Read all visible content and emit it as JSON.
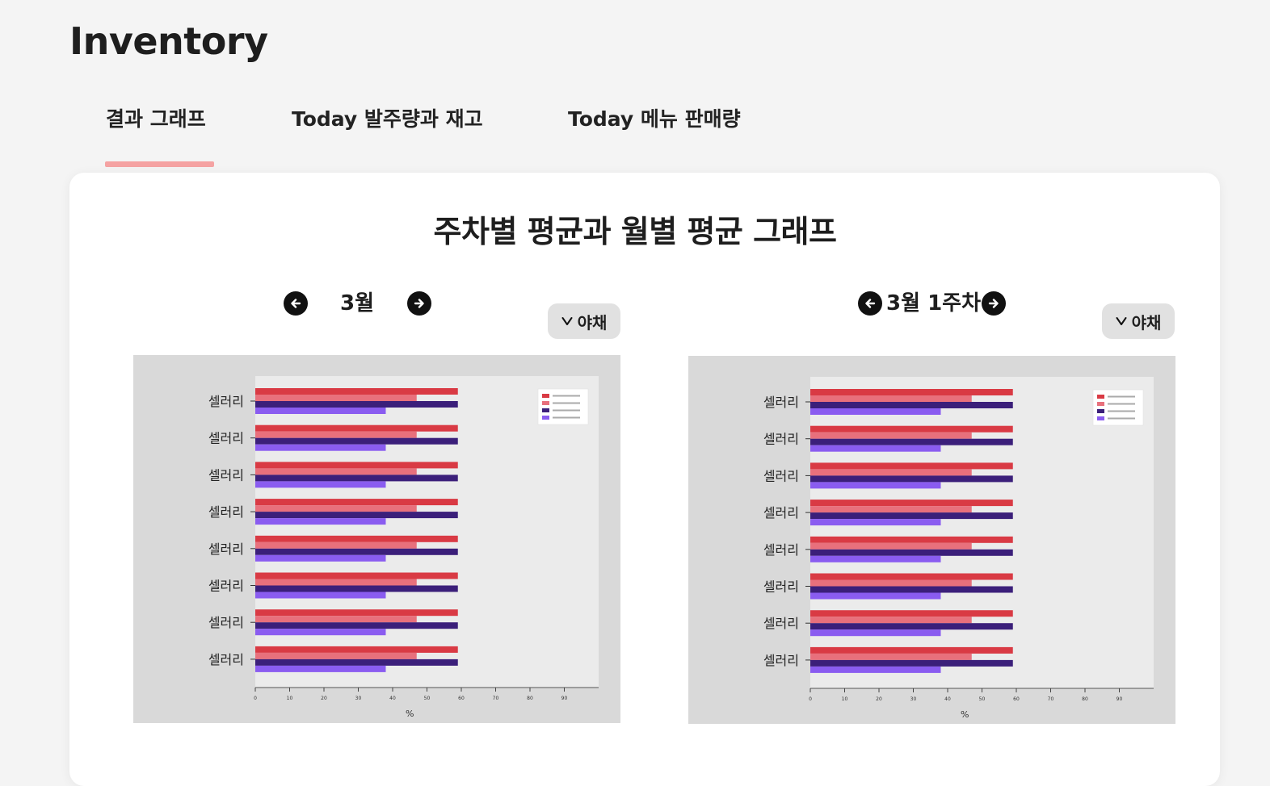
{
  "app": {
    "title": "Inventory"
  },
  "tabs": [
    {
      "label": "결과 그래프",
      "active": true
    },
    {
      "label": "Today 발주량과 재고",
      "active": false
    },
    {
      "label": "Today 메뉴 판매량",
      "active": false
    }
  ],
  "card": {
    "title": "주차별 평균과 월별 평균 그래프"
  },
  "panels": [
    {
      "period_label": "3월",
      "filter_label": "야채"
    },
    {
      "period_label": "3월 1주차",
      "filter_label": "야채"
    }
  ],
  "colors": {
    "accent_underline": "#f5a3a3",
    "series1": "#d93a44",
    "series2": "#e8707c",
    "series3": "#3b1f7a",
    "series4": "#8a5cf0"
  },
  "chart_data": [
    {
      "type": "bar",
      "orientation": "horizontal",
      "categories": [
        "셀러리",
        "셀러리",
        "셀러리",
        "셀러리",
        "셀러리",
        "셀러리",
        "셀러리",
        "셀러리"
      ],
      "series": [
        {
          "values": [
            59,
            59,
            59,
            59,
            59,
            59,
            59,
            59
          ],
          "color": "#d93a44"
        },
        {
          "values": [
            47,
            47,
            47,
            47,
            47,
            47,
            47,
            47
          ],
          "color": "#e8707c"
        },
        {
          "values": [
            59,
            59,
            59,
            59,
            59,
            59,
            59,
            59
          ],
          "color": "#3b1f7a"
        },
        {
          "values": [
            38,
            38,
            38,
            38,
            38,
            38,
            38,
            38
          ],
          "color": "#8a5cf0"
        }
      ],
      "xlabel": "%",
      "xlim": [
        0,
        100
      ],
      "xticks": [
        "0",
        "10",
        "20",
        "30",
        "40",
        "50",
        "60",
        "70",
        "80",
        "90"
      ],
      "legend_placement": "top-right",
      "grid": false
    },
    {
      "type": "bar",
      "orientation": "horizontal",
      "categories": [
        "셀러리",
        "셀러리",
        "셀러리",
        "셀러리",
        "셀러리",
        "셀러리",
        "셀러리",
        "셀러리"
      ],
      "series": [
        {
          "values": [
            59,
            59,
            59,
            59,
            59,
            59,
            59,
            59
          ],
          "color": "#d93a44"
        },
        {
          "values": [
            47,
            47,
            47,
            47,
            47,
            47,
            47,
            47
          ],
          "color": "#e8707c"
        },
        {
          "values": [
            59,
            59,
            59,
            59,
            59,
            59,
            59,
            59
          ],
          "color": "#3b1f7a"
        },
        {
          "values": [
            38,
            38,
            38,
            38,
            38,
            38,
            38,
            38
          ],
          "color": "#8a5cf0"
        }
      ],
      "xlabel": "%",
      "xlim": [
        0,
        100
      ],
      "xticks": [
        "0",
        "10",
        "20",
        "30",
        "40",
        "50",
        "60",
        "70",
        "80",
        "90"
      ],
      "legend_placement": "top-right",
      "grid": false
    }
  ]
}
